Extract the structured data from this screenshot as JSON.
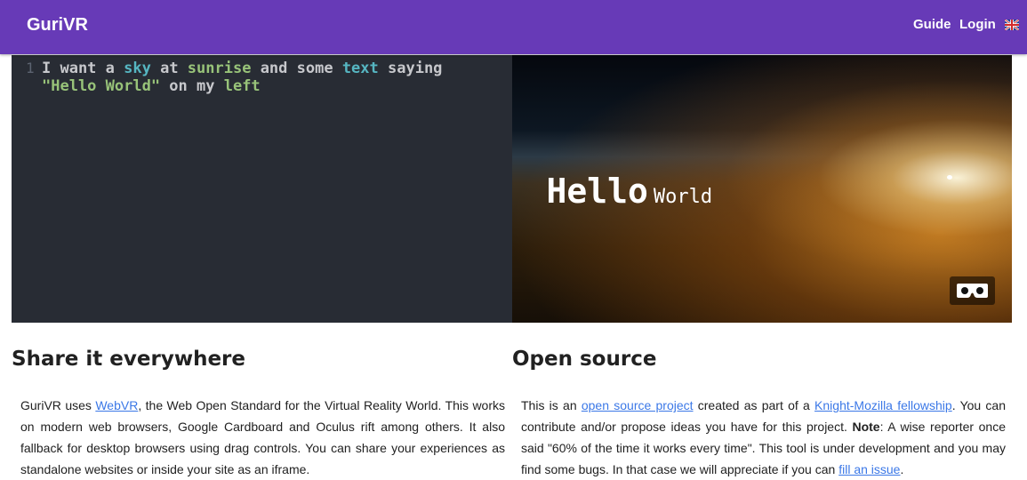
{
  "navbar": {
    "brand": "GuriVR",
    "links": [
      {
        "label": "Guide"
      },
      {
        "label": "Login"
      }
    ],
    "language_icon": "uk-flag-icon"
  },
  "editor": {
    "line_number": "1",
    "line1": [
      {
        "text": "I want a ",
        "style": "plain"
      },
      {
        "text": "sky",
        "style": "blue"
      },
      {
        "text": " at ",
        "style": "plain"
      },
      {
        "text": "sunrise",
        "style": "green"
      },
      {
        "text": " and some ",
        "style": "plain"
      },
      {
        "text": "text",
        "style": "blue"
      },
      {
        "text": " saying",
        "style": "plain"
      }
    ],
    "line2": [
      {
        "text": "\"Hello World\"",
        "style": "green"
      },
      {
        "text": " on my ",
        "style": "plain"
      },
      {
        "text": "left",
        "style": "green"
      }
    ],
    "colors": {
      "plain": "#c7c8cc",
      "blue": "#56b6c2",
      "green": "#98c379"
    }
  },
  "preview": {
    "text_word1": "Hello",
    "text_word2": "World",
    "vr_icon": "cardboard-vr-icon"
  },
  "sections": {
    "share": {
      "title": "Share it everywhere",
      "pre_link": "GuriVR uses ",
      "link": "WebVR",
      "post_link": ", the Web Open Standard for the Virtual Reality World. This works on modern web browsers, Google Cardboard and Oculus rift among others. It also fallback for desktop browsers using drag controls. You can share your experiences as standalone websites or inside your site as an iframe."
    },
    "open_source": {
      "title": "Open source",
      "text1": "This is an ",
      "link1": "open source project",
      "text2": " created as part of a ",
      "link2": "Knight-Mozilla fellowship",
      "text3": ". You can contribute and/or propose ideas you have for this project. ",
      "note_label": "Note",
      "text4": ": A wise reporter once said \"60% of the time it works every time\". This tool is under development and you may find some bugs. In that case we will appreciate if you can ",
      "link3": "fill an issue",
      "text5": "."
    }
  },
  "accent_color": "#673ab7",
  "link_color": "#3b78e7"
}
